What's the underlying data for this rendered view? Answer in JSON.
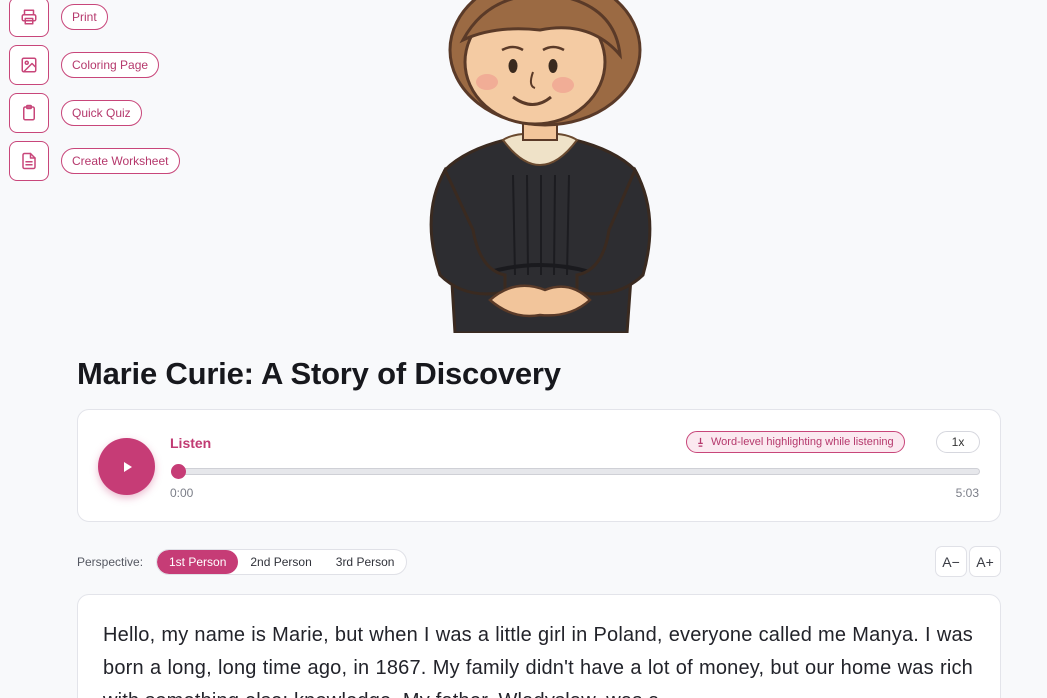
{
  "actions": [
    {
      "label": "Print",
      "icon": "printer-icon"
    },
    {
      "label": "Coloring Page",
      "icon": "image-icon"
    },
    {
      "label": "Quick Quiz",
      "icon": "clipboard-icon"
    },
    {
      "label": "Create Worksheet",
      "icon": "document-icon"
    }
  ],
  "title": "Marie Curie: A Story of Discovery",
  "player": {
    "listen_label": "Listen",
    "highlight_label": "Word-level highlighting while listening",
    "speed": "1x",
    "current_time": "0:00",
    "duration": "5:03",
    "progress": 0
  },
  "perspective": {
    "label": "Perspective:",
    "options": [
      "1st Person",
      "2nd Person",
      "3rd Person"
    ],
    "selected": "1st Person"
  },
  "font_controls": {
    "decrease": "A−",
    "increase": "A+"
  },
  "story": {
    "text": "Hello, my name is Marie, but when I was a little girl in Poland, everyone called me Manya. I was born a long, long time ago, in 1867. My family didn't have a lot of money, but our home was rich with something else: knowledge. My father, Wladyslaw, was a"
  },
  "colors": {
    "accent": "#c63c76",
    "accent_light": "#fbe9f0",
    "background": "#f8f9fb"
  }
}
